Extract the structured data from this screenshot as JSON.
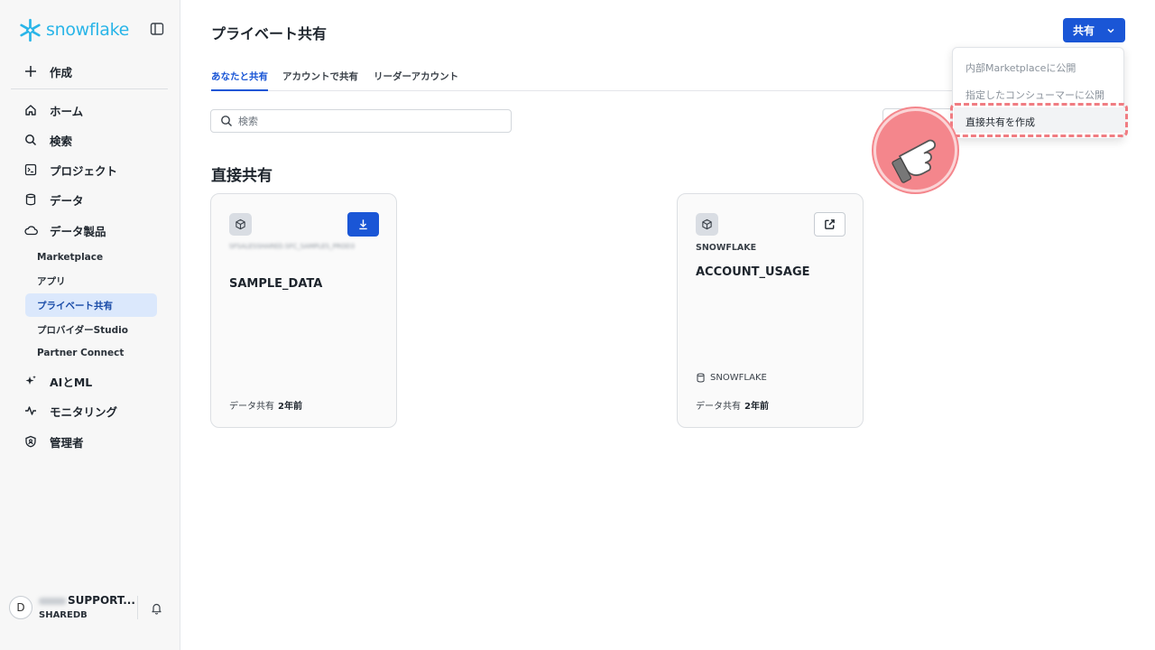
{
  "app": {
    "brand": "snowflake",
    "brand_color": "#29b5e8",
    "accent": "#1a56d6"
  },
  "sidebar": {
    "create": {
      "label": "作成",
      "icon": "plus-icon"
    },
    "items": [
      {
        "label": "ホーム",
        "icon": "home-icon"
      },
      {
        "label": "検索",
        "icon": "search-icon"
      },
      {
        "label": "プロジェクト",
        "icon": "terminal-icon"
      },
      {
        "label": "データ",
        "icon": "database-icon"
      },
      {
        "label": "データ製品",
        "icon": "cloud-icon"
      },
      {
        "label": "AIとML",
        "icon": "sparkle-icon"
      },
      {
        "label": "モニタリング",
        "icon": "activity-icon"
      },
      {
        "label": "管理者",
        "icon": "shield-icon"
      }
    ],
    "sub_items": [
      {
        "label": "Marketplace"
      },
      {
        "label": "アプリ"
      },
      {
        "label": "プライベート共有",
        "active": true
      },
      {
        "label": "プロバイダーStudio"
      },
      {
        "label": "Partner Connect"
      }
    ],
    "user": {
      "avatar": "D",
      "name": "SUPPORT...",
      "role": "SHAREDB"
    }
  },
  "main": {
    "title": "プライベート共有",
    "share_button": "共有",
    "tabs": [
      {
        "label": "あなたと共有",
        "active": true
      },
      {
        "label": "アカウントで共有"
      },
      {
        "label": "リーダーアカウント"
      }
    ],
    "search": {
      "placeholder": "検索"
    },
    "section_title": "直接共有",
    "cards": [
      {
        "provider_blurred": "SFSALESSHARED.SFC_SAMPLES_PROD3",
        "name": "SAMPLE_DATA",
        "action_icon": "download-icon",
        "meta_label": "データ共有",
        "meta_value": "2年前"
      },
      {
        "provider": "SNOWFLAKE",
        "name": "ACCOUNT_USAGE",
        "db": "SNOWFLAKE",
        "action_icon": "external-link-icon",
        "meta_label": "データ共有",
        "meta_value": "2年前"
      }
    ]
  },
  "dropdown": {
    "items": [
      {
        "label": "内部Marketplaceに公開",
        "enabled": false
      },
      {
        "label": "指定したコンシューマーに公開",
        "enabled": false
      },
      {
        "label": "直接共有を作成",
        "enabled": true
      }
    ]
  }
}
